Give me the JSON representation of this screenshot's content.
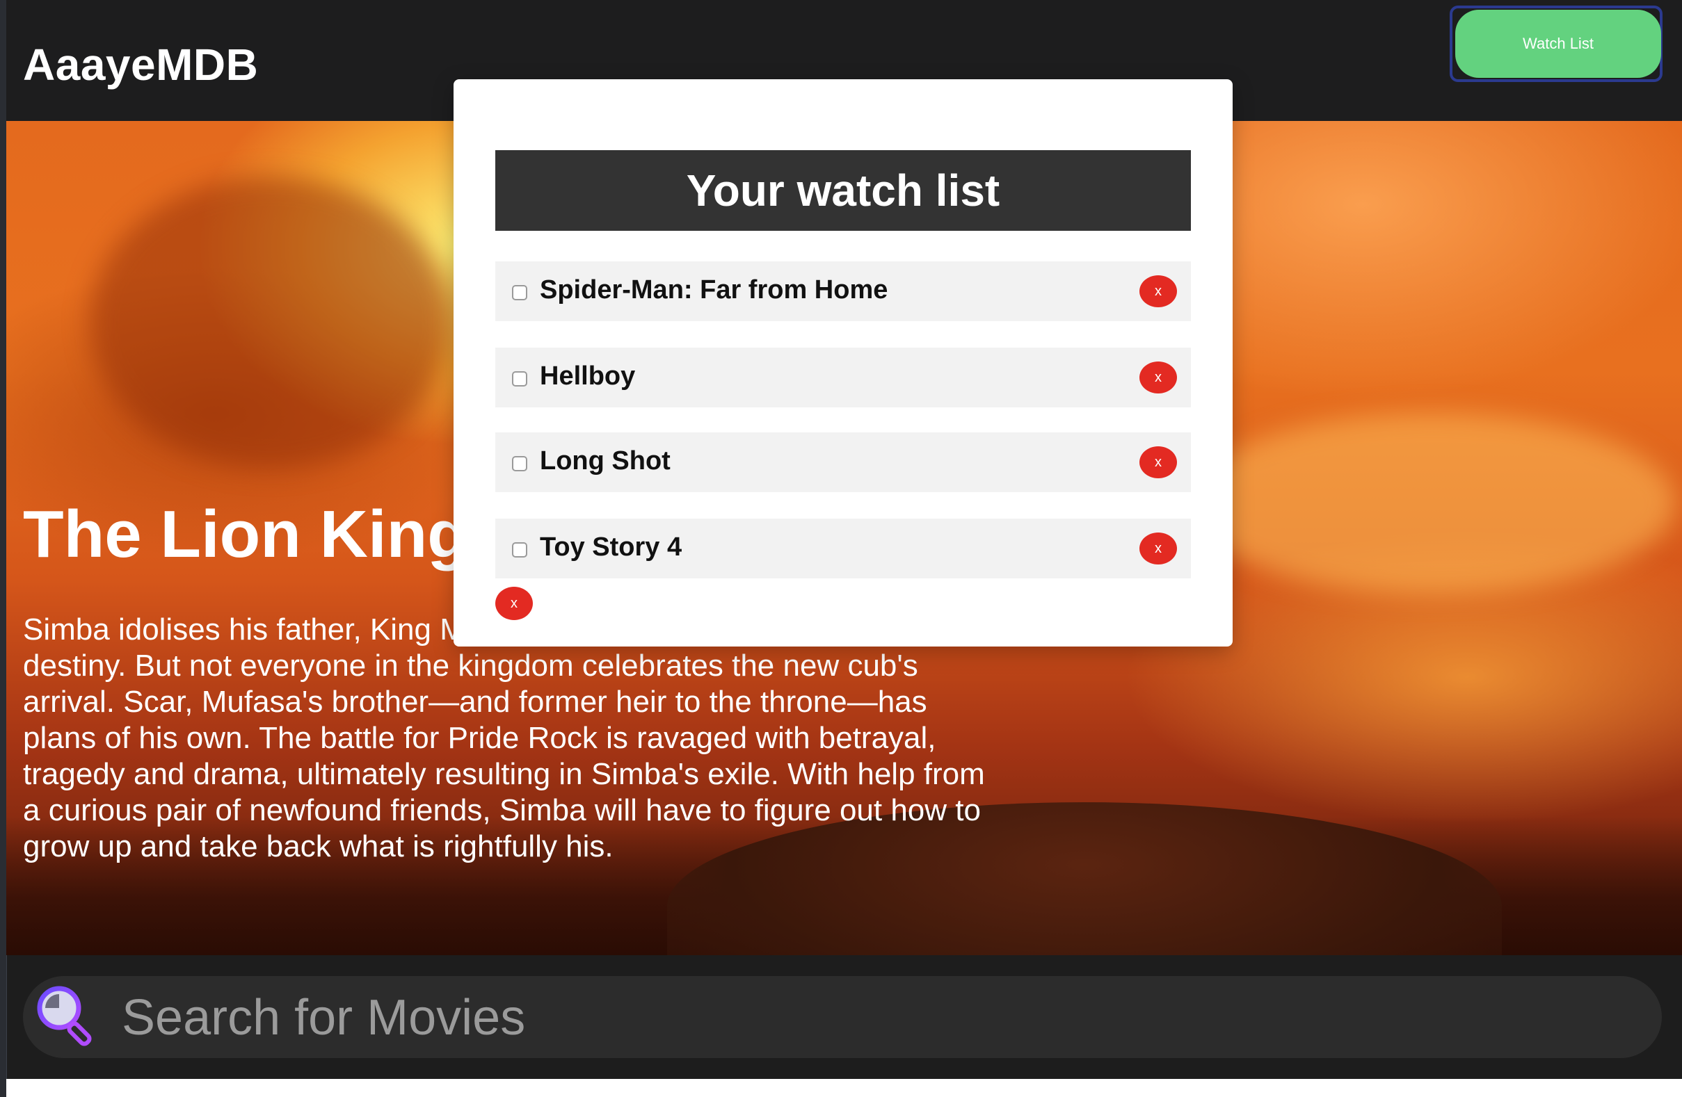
{
  "header": {
    "brand": "AaayeMDB",
    "watch_list_button": "Watch List",
    "accent_color": "#63d27f"
  },
  "hero": {
    "title": "The Lion King",
    "description": "Simba idolises his father, King Mufasa, and takes to heart his own royal destiny. But not everyone in the kingdom celebrates the new cub's arrival. Scar, Mufasa's brother—and former heir to the throne—has plans of his own. The battle for Pride Rock is ravaged with betrayal, tragedy and drama, ultimately resulting in Simba's exile. With help from a curious pair of newfound friends, Simba will have to figure out how to grow up and take back what is rightfully his."
  },
  "modal": {
    "title": "Your watch list",
    "items": [
      {
        "label": "Spider-Man: Far from Home",
        "checked": false,
        "remove": "x"
      },
      {
        "label": "Hellboy",
        "checked": false,
        "remove": "x"
      },
      {
        "label": "Long Shot",
        "checked": false,
        "remove": "x"
      },
      {
        "label": "Toy Story 4",
        "checked": false,
        "remove": "x"
      }
    ],
    "clear_button": "x",
    "remove_color": "#e32a22"
  },
  "search": {
    "placeholder": "Search for Movies",
    "icon": "magnifier-icon"
  }
}
